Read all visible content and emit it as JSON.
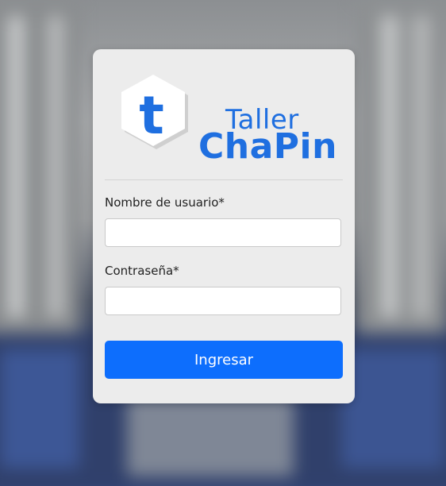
{
  "brand": {
    "logo_letter": "t",
    "name_line1": "Taller",
    "name_line2": "ChaPin"
  },
  "form": {
    "username_label": "Nombre de usuario*",
    "username_value": "",
    "password_label": "Contraseña*",
    "password_value": "",
    "submit_label": "Ingresar"
  },
  "colors": {
    "accent": "#0d6efd",
    "brand_text": "#1f6fe0",
    "card_bg": "#ececec"
  },
  "icons": {
    "logo": "hexagon-t-logo-icon"
  }
}
